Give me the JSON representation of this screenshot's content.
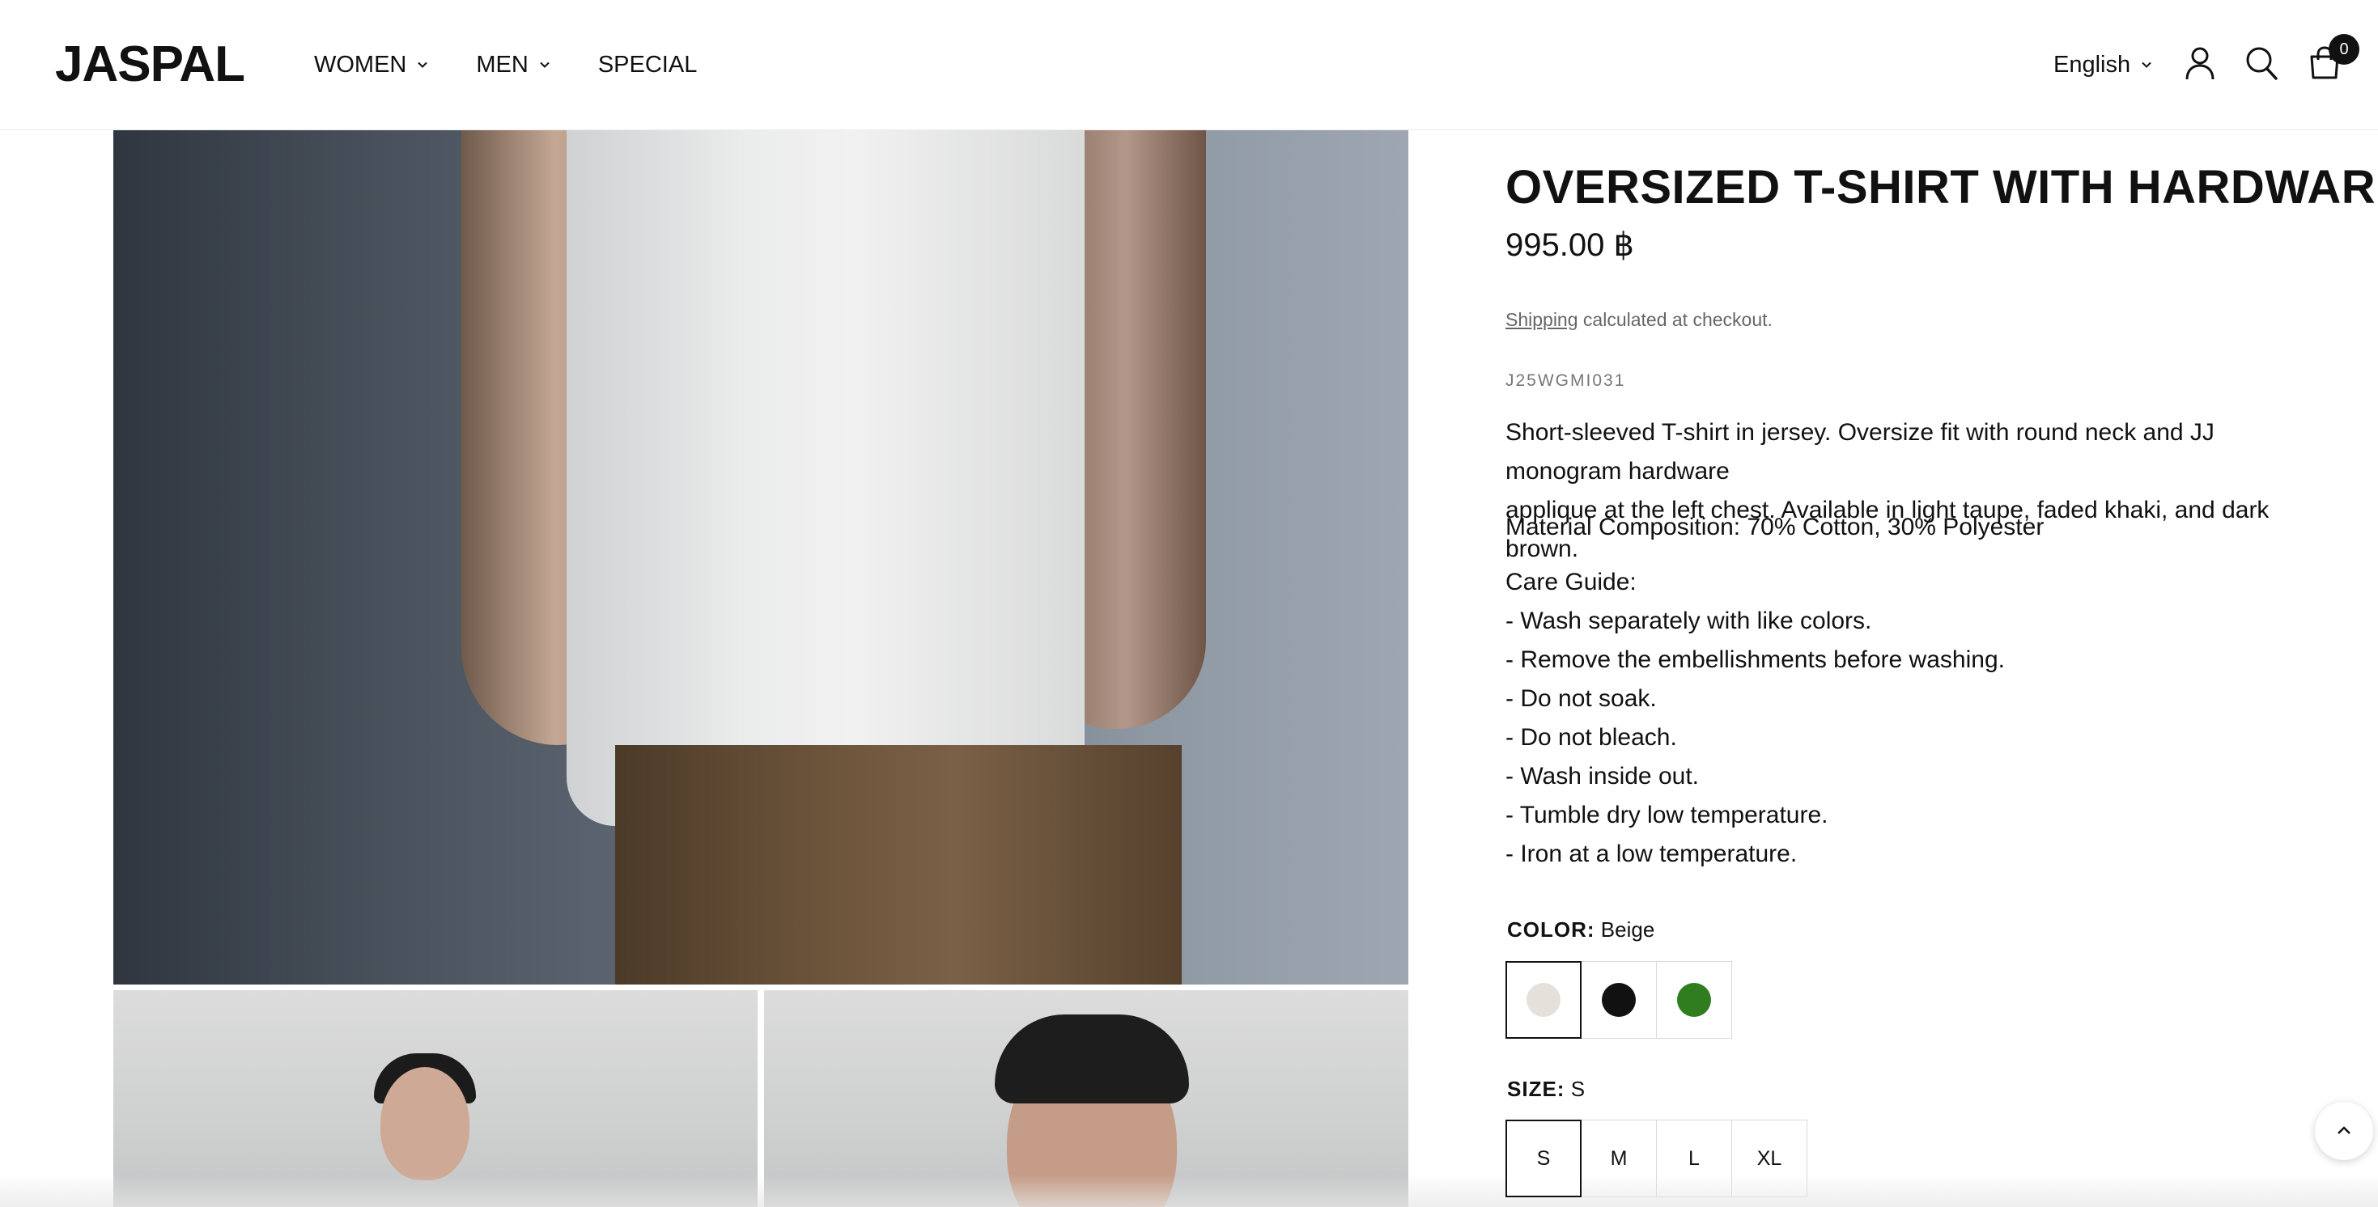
{
  "header": {
    "logo": "JASPAL",
    "nav": [
      {
        "label": "WOMEN",
        "has_dropdown": true
      },
      {
        "label": "MEN",
        "has_dropdown": true
      },
      {
        "label": "SPECIAL",
        "has_dropdown": false
      }
    ],
    "language": "English",
    "cart_count": "0",
    "icons": [
      "account-icon",
      "search-icon",
      "cart-icon"
    ]
  },
  "product": {
    "title": "OVERSIZED T-SHIRT WITH HARDWARE",
    "price": "995.00 ฿",
    "shipping_link": "Shipping",
    "shipping_rest": " calculated at checkout.",
    "sku": "J25WGMI031",
    "description_line1": "Short-sleeved T-shirt in jersey. Oversize fit with round neck and JJ monogram hardware",
    "description_line2": "applique at the left chest. Available in light taupe, faded khaki, and dark brown.",
    "material": "Material Composition: 70% Cotton, 30% Polyester",
    "care_title": "Care Guide:",
    "care_items": [
      "- Wash separately with like colors.",
      "- Remove the embellishments before washing.",
      "- Do not soak.",
      "- Do not bleach.",
      "- Wash inside out.",
      "- Tumble dry low temperature.",
      "- Iron at a low temperature."
    ],
    "color": {
      "label": "COLOR:",
      "selected": "Beige",
      "options": [
        {
          "name": "Beige",
          "hex": "#e6e0da"
        },
        {
          "name": "Black",
          "hex": "#111111"
        },
        {
          "name": "Green",
          "hex": "#2f7d1f"
        }
      ]
    },
    "size": {
      "label": "SIZE:",
      "selected": "S",
      "options": [
        "S",
        "M",
        "L",
        "XL"
      ]
    }
  }
}
